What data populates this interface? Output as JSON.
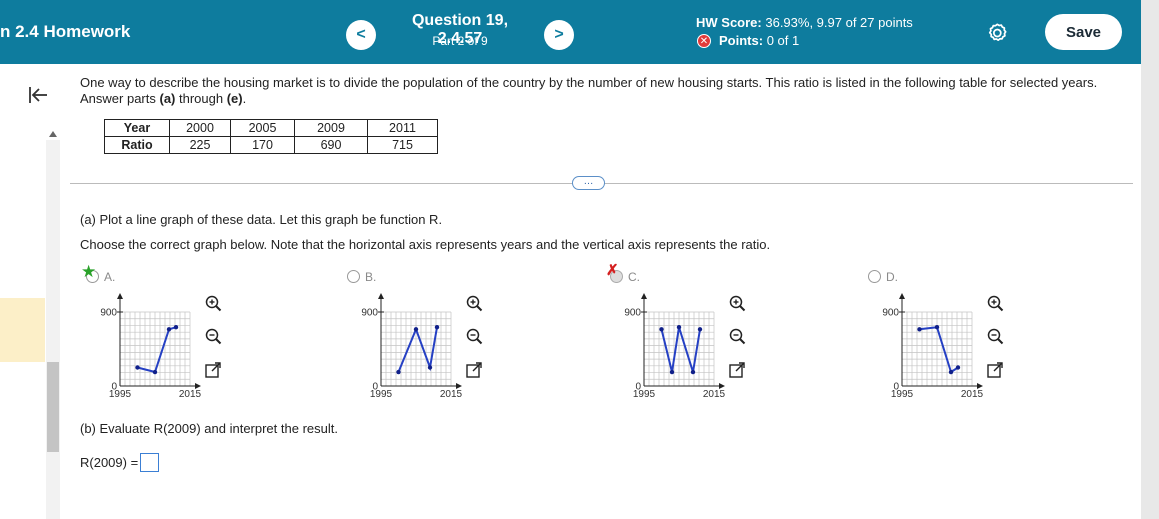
{
  "header": {
    "course_title": "n 2.4 Homework",
    "question_title": "Question 19, 2.4.57",
    "question_part": "Part 2 of 9",
    "hw_score_label": "HW Score:",
    "hw_score_value": "36.93%, 9.97 of 27 points",
    "points_label": "Points:",
    "points_value": "0 of 1",
    "prev_icon": "<",
    "next_icon": ">",
    "save_label": "Save"
  },
  "question": {
    "intro_text": "One way to describe the housing market is to divide the population of the country by the number of new housing starts. This ratio is listed in the following table for selected years.",
    "intro_prefix": "Answer parts ",
    "intro_part_a": "(a)",
    "intro_mid": " through ",
    "intro_part_e": "(e)",
    "intro_suffix": ".",
    "table": {
      "headers": [
        "Year",
        "Ratio"
      ],
      "years": [
        "2000",
        "2005",
        "2009",
        "2011"
      ],
      "ratios": [
        "225",
        "170",
        "690",
        "715"
      ]
    },
    "more_label": "…",
    "part_a_text": "(a) Plot a line graph of these data. Let this graph be function R.",
    "instruction_text": "Choose the correct graph below. Note that the horizontal axis represents years and the vertical axis represents the ratio.",
    "part_b_text": "(b) Evaluate R(2009) and interpret the result.",
    "answer_prefix": "R(2009) ="
  },
  "options": [
    {
      "label": "A.",
      "mark": "correct"
    },
    {
      "label": "B.",
      "mark": "none"
    },
    {
      "label": "C.",
      "mark": "incorrect"
    },
    {
      "label": "D.",
      "mark": "none"
    }
  ],
  "graph_axis": {
    "x_min_label": "1995",
    "x_max_label": "2015",
    "y_min_label": "0",
    "y_max_label": "900"
  },
  "chart_data": [
    {
      "type": "line",
      "x": [
        2000,
        2005,
        2009,
        2011
      ],
      "y": [
        225,
        170,
        690,
        715
      ],
      "xlim": [
        1995,
        2015
      ],
      "ylim": [
        0,
        900
      ]
    },
    {
      "type": "line",
      "x": [
        2000,
        2005,
        2009,
        2011
      ],
      "y": [
        170,
        690,
        225,
        715
      ],
      "xlim": [
        1995,
        2015
      ],
      "ylim": [
        0,
        900
      ]
    },
    {
      "type": "line",
      "x": [
        2000,
        2003,
        2005,
        2009,
        2011
      ],
      "y": [
        690,
        170,
        715,
        170,
        690
      ],
      "xlim": [
        1995,
        2015
      ],
      "ylim": [
        0,
        900
      ]
    },
    {
      "type": "line",
      "x": [
        2000,
        2005,
        2009,
        2011
      ],
      "y": [
        690,
        715,
        170,
        225
      ],
      "xlim": [
        1995,
        2015
      ],
      "ylim": [
        0,
        900
      ]
    }
  ],
  "colors": {
    "header_bg": "#0e7c9e",
    "line": "#2540c4",
    "point": "#10208a",
    "correct": "#2aa22a",
    "incorrect": "#d42020"
  },
  "icons": {
    "zoom_in": "zoom-in-icon",
    "zoom_out": "zoom-out-icon",
    "popout": "popout-icon",
    "settings": "gear-icon",
    "collapse": "collapse-left-icon"
  }
}
